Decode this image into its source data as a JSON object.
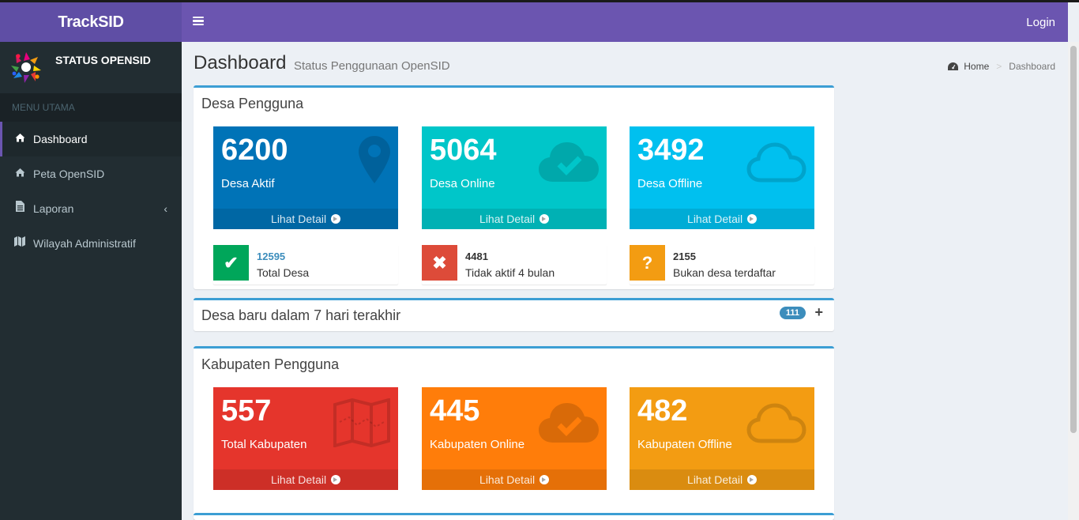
{
  "app": {
    "brand": "TrackSID",
    "login_label": "Login"
  },
  "sidebar": {
    "user_name": "STATUS OPENSID",
    "menu_header": "MENU UTAMA",
    "items": [
      {
        "label": "Dashboard",
        "icon": "home-icon",
        "active": true
      },
      {
        "label": "Peta OpenSID",
        "icon": "home-icon"
      },
      {
        "label": "Laporan",
        "icon": "file-icon",
        "chevron": "chevron-left-icon"
      },
      {
        "label": "Wilayah Administratif",
        "icon": "map-icon"
      }
    ]
  },
  "header": {
    "title": "Dashboard",
    "subtitle": "Status Penggunaan OpenSID",
    "breadcrumb": {
      "home": "Home",
      "separator": ">",
      "current": "Dashboard"
    }
  },
  "desa": {
    "title": "Desa Pengguna",
    "stats": [
      {
        "value": "6200",
        "label": "Desa Aktif",
        "footer": "Lihat Detail",
        "color": "#0073b7",
        "icon": "map-marker-icon"
      },
      {
        "value": "5064",
        "label": "Desa Online",
        "footer": "Lihat Detail",
        "color": "#00c0c8",
        "icon": "cloud-check-icon"
      },
      {
        "value": "3492",
        "label": "Desa Offline",
        "footer": "Lihat Detail",
        "color": "#00c0ef",
        "icon": "cloud-icon"
      }
    ],
    "info": [
      {
        "value": "12595",
        "text": "Total Desa",
        "color": "#00a65a",
        "icon": "check-icon",
        "symbol": "✔"
      },
      {
        "value": "4481",
        "text": "Tidak aktif 4 bulan",
        "color": "#dd4b39",
        "icon": "times-icon",
        "symbol": "✖"
      },
      {
        "value": "2155",
        "text": "Bukan desa terdaftar",
        "color": "#f39c12",
        "icon": "question-icon",
        "symbol": "?"
      }
    ]
  },
  "desa_baru": {
    "title": "Desa baru dalam 7 hari terakhir",
    "badge": "111",
    "expand_symbol": "+"
  },
  "kabupaten": {
    "title": "Kabupaten Pengguna",
    "stats": [
      {
        "value": "557",
        "label": "Total Kabupaten",
        "footer": "Lihat Detail",
        "color": "#dd4b39",
        "icon": "map-icon"
      },
      {
        "value": "445",
        "label": "Kabupaten Online",
        "footer": "Lihat Detail",
        "color": "#ff851b",
        "icon": "cloud-check-icon"
      },
      {
        "value": "482",
        "label": "Kabupaten Offline",
        "footer": "Lihat Detail",
        "color": "#f39c12",
        "icon": "cloud-icon"
      }
    ]
  }
}
